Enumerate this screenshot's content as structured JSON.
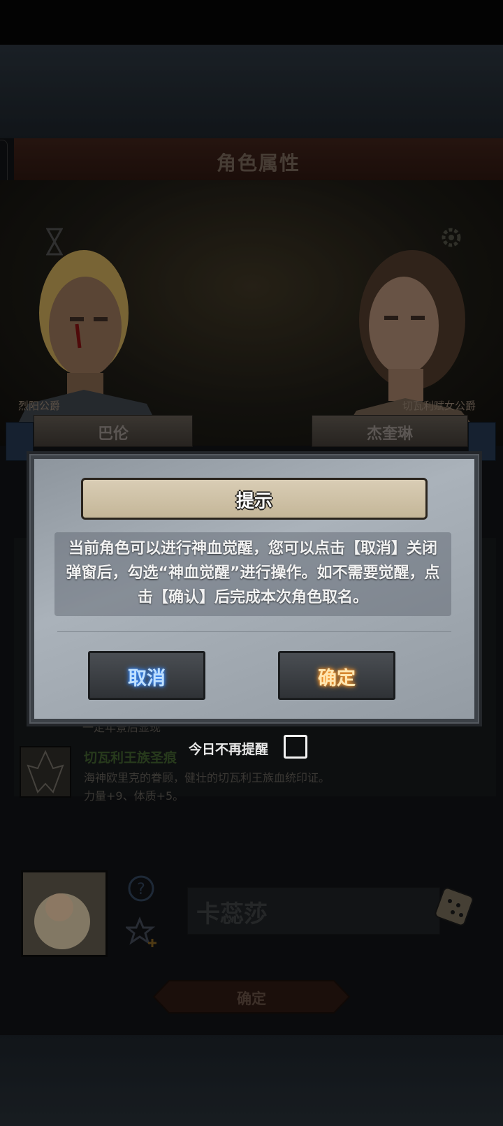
{
  "page": {
    "title": "角色属性"
  },
  "characters": {
    "left": {
      "title": "烈阳公爵",
      "name": "巴伦"
    },
    "right": {
      "title": "切瓦利赋女公爵",
      "name": "杰奎琳"
    }
  },
  "traits": {
    "partial_desc": "一定年景后显现",
    "item": {
      "name": "切瓦利王族圣痕",
      "desc": "海神欧里克的眷顾，健壮的切瓦利王族血统印证。",
      "stat": "力量+9、体质+5。"
    }
  },
  "naming": {
    "name_value": "卡蕊莎",
    "confirm_label": "确定"
  },
  "dialog": {
    "title": "提示",
    "message": "当前角色可以进行神血觉醒，您可以点击【取消】关闭弹窗后，勾选“神血觉醒”进行操作。如不需要觉醒，点击【确认】后完成本次角色取名。",
    "cancel_label": "取消",
    "ok_label": "确定"
  },
  "reminder": {
    "label": "今日不再提醒",
    "checked": false
  },
  "colors": {
    "cancel_glow": "#3a8cff",
    "ok_glow": "#ff9a2a",
    "trait_name": "#3d5a2c"
  },
  "icons": [
    "hourglass-icon",
    "gear-icon",
    "help-icon",
    "star-add-icon",
    "dice-icon",
    "trait-icon",
    "emblem-icon",
    "checkbox"
  ]
}
